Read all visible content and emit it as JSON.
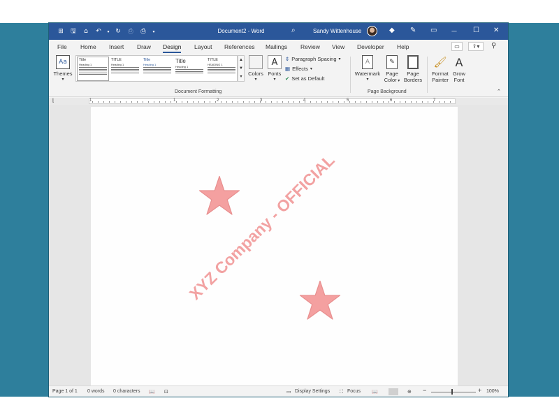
{
  "titlebar": {
    "doc_title": "Document2 - Word",
    "user_name": "Sandy Wittenhouse",
    "qat": {
      "autosave": "⊞",
      "save": "🖫",
      "open": "⌂",
      "undo": "↶",
      "redo": "↻",
      "print": "⎙",
      "more": "▾"
    },
    "icons": {
      "search": "⌕",
      "diamond": "◆",
      "pen": "✎",
      "restore_mode": "▭",
      "minimize": "—",
      "maximize": "☐",
      "close": "✕"
    }
  },
  "tabs": [
    "File",
    "Home",
    "Insert",
    "Draw",
    "Design",
    "Layout",
    "References",
    "Mailings",
    "Review",
    "View",
    "Developer",
    "Help"
  ],
  "active_tab": "Design",
  "ribbon": {
    "themes_label": "Themes",
    "style_thumbs": [
      {
        "title": "Title",
        "sub": "Heading 1"
      },
      {
        "title": "TITLE",
        "sub": "Heading 1"
      },
      {
        "title": "Title",
        "sub": "Heading 1"
      },
      {
        "title": "Title",
        "sub": "Heading 1"
      },
      {
        "title": "TITLE",
        "sub": "HEADING 1"
      }
    ],
    "colors_label": "Colors",
    "fonts_label": "Fonts",
    "paragraph_spacing": "Paragraph Spacing",
    "effects": "Effects",
    "set_default": "Set as Default",
    "group_document_formatting": "Document Formatting",
    "watermark": "Watermark",
    "page_color_1": "Page",
    "page_color_2": "Color",
    "page_borders_1": "Page",
    "page_borders_2": "Borders",
    "group_page_background": "Page Background",
    "format_painter_1": "Format",
    "format_painter_2": "Painter",
    "grow_font_1": "Grow",
    "grow_font_2": "Font"
  },
  "ruler_numbers": [
    "1",
    "1",
    "2",
    "3",
    "4",
    "5",
    "6",
    "7"
  ],
  "document": {
    "watermark_text": "XYZ Company - OFFICIAL",
    "watermark_color": "#f2a2a2",
    "star_color": "#f4a0a0"
  },
  "statusbar": {
    "page": "Page 1 of 1",
    "words": "0 words",
    "characters": "0 characters",
    "display_settings": "Display Settings",
    "focus": "Focus",
    "zoom": "100%"
  },
  "colors": {
    "accent": "#2b579a",
    "backdrop": "#2e7f9c"
  }
}
